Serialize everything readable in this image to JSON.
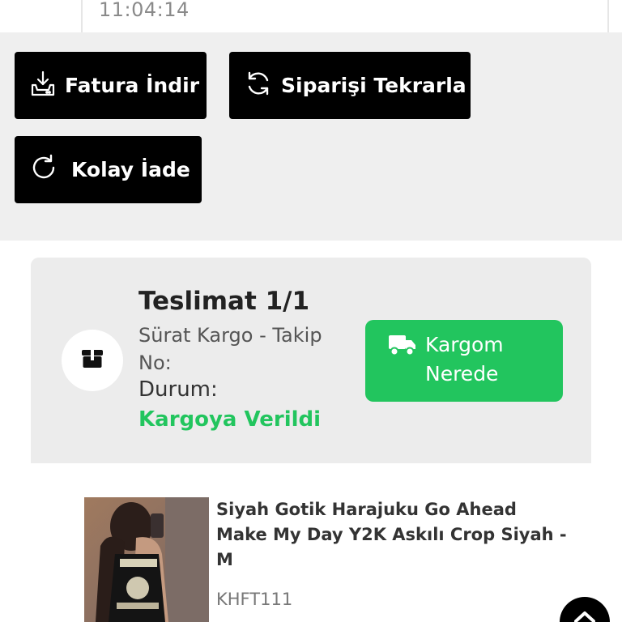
{
  "order": {
    "time": "11:04:14"
  },
  "actions": {
    "invoice_label": "Fatura İndir",
    "repeat_label": "Siparişi Tekrarla",
    "return_label": "Kolay İade"
  },
  "delivery": {
    "title": "Teslimat 1/1",
    "carrier_line": "Sürat Kargo - Takip No:",
    "status_label": "Durum:",
    "status_value": "Kargoya Verildi",
    "track_button_line1": "Kargom",
    "track_button_line2": "Nerede"
  },
  "product": {
    "name": "Siyah Gotik Harajuku Go Ahead Make My Day Y2K Askılı Crop Siyah - M",
    "sku": "KHFT111"
  },
  "colors": {
    "accent_green": "#22c55e",
    "button_black": "#000000",
    "band_gray": "#efefef"
  },
  "icons": [
    "download-invoice-icon",
    "repeat-order-icon",
    "return-icon",
    "package-icon",
    "truck-icon",
    "chevron-up-icon"
  ]
}
